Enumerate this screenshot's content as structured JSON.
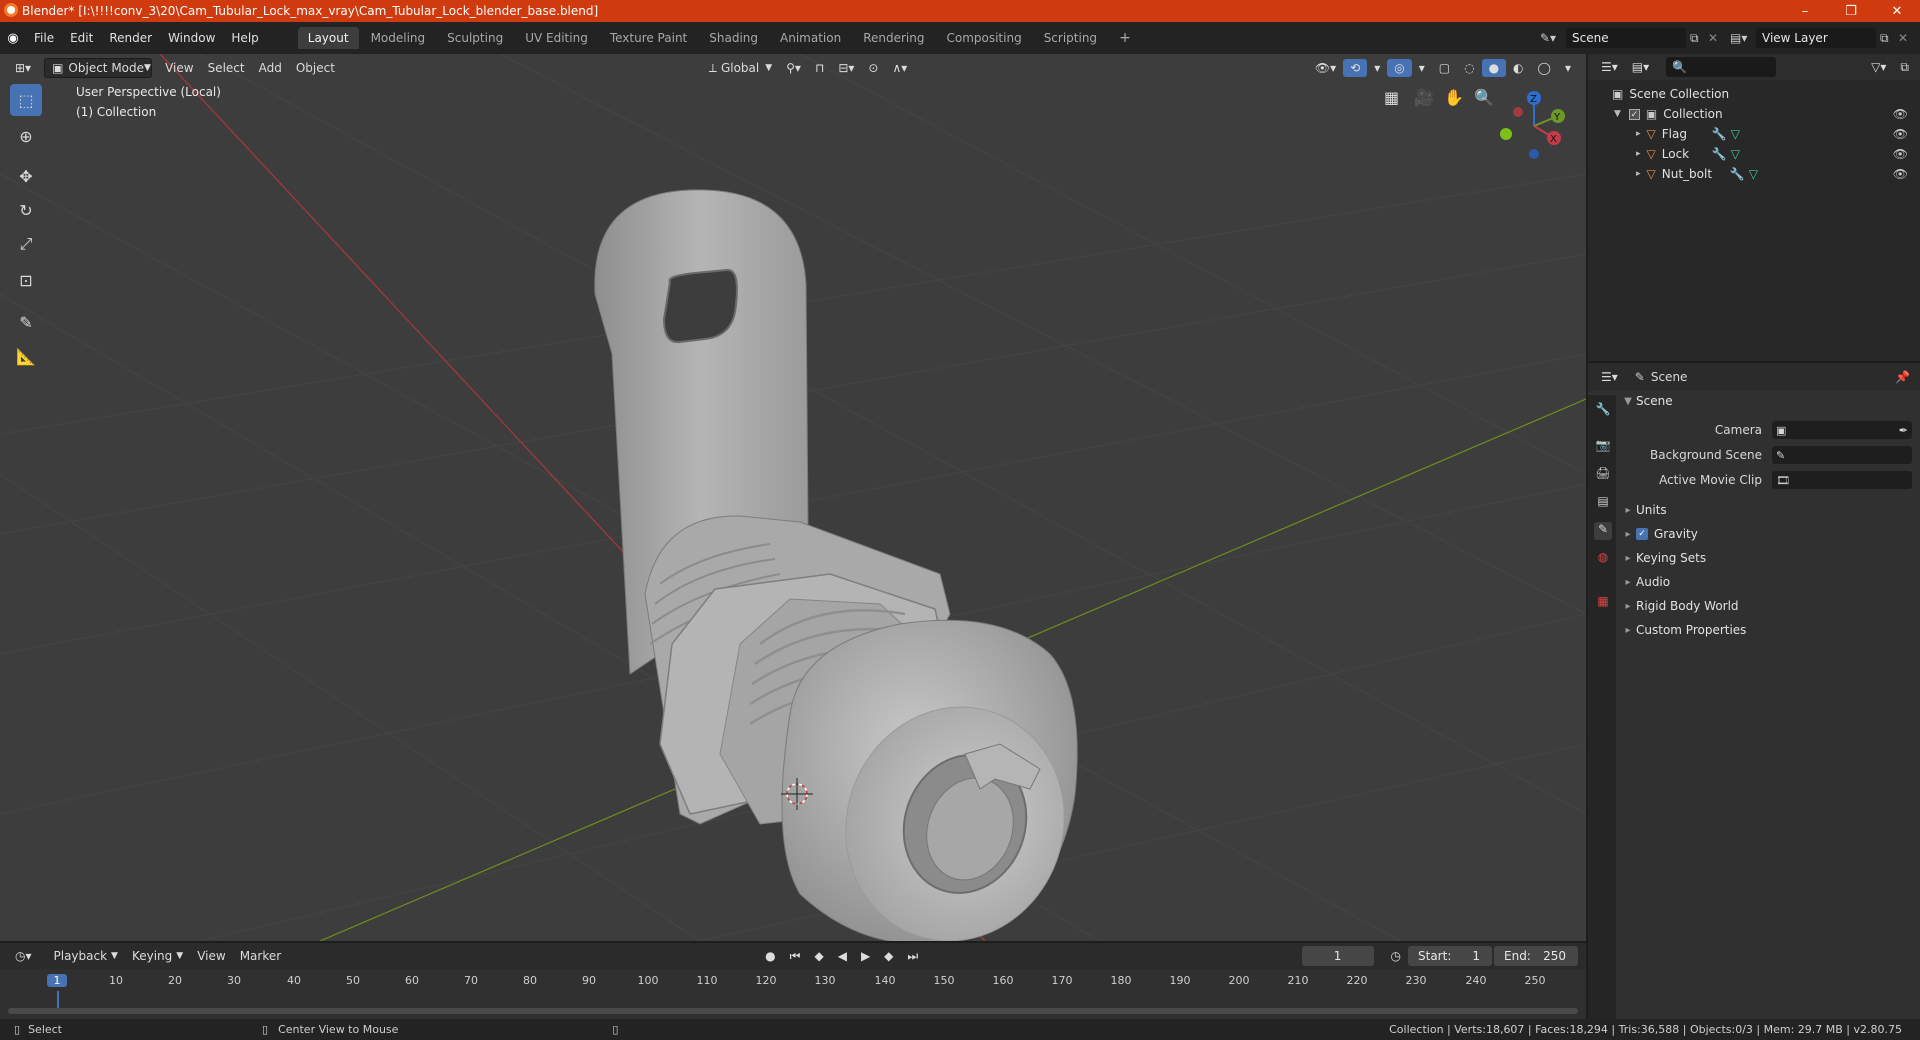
{
  "window": {
    "title": "Blender* [I:\\!!!!conv_3\\20\\Cam_Tubular_Lock_max_vray\\Cam_Tubular_Lock_blender_base.blend]",
    "minimize": "–",
    "maximize": "❐",
    "close": "✕"
  },
  "menubar": {
    "items": [
      "File",
      "Edit",
      "Render",
      "Window",
      "Help"
    ]
  },
  "workspaces": [
    "Layout",
    "Modeling",
    "Sculpting",
    "UV Editing",
    "Texture Paint",
    "Shading",
    "Animation",
    "Rendering",
    "Compositing",
    "Scripting"
  ],
  "active_workspace": "Layout",
  "scene_selector": {
    "value": "Scene"
  },
  "view_layer_selector": {
    "value": "View Layer"
  },
  "viewport": {
    "mode": "Object Mode",
    "menus": [
      "View",
      "Select",
      "Add",
      "Object"
    ],
    "transform_orientation": "Global",
    "overlay_text": {
      "line1": "User Perspective (Local)",
      "line2": "(1) Collection"
    },
    "gizmo": {
      "z": "Z",
      "y": "Y",
      "x": "X"
    }
  },
  "outliner": {
    "root": "Scene Collection",
    "collection": "Collection",
    "objects": [
      "Flag",
      "Lock",
      "Nut_bolt"
    ]
  },
  "properties": {
    "header": "Scene",
    "section": "Scene",
    "fields": [
      {
        "label": "Camera",
        "value": ""
      },
      {
        "label": "Background Scene",
        "value": ""
      },
      {
        "label": "Active Movie Clip",
        "value": ""
      }
    ],
    "panels": [
      "Units",
      "Gravity",
      "Keying Sets",
      "Audio",
      "Rigid Body World",
      "Custom Properties"
    ],
    "gravity_checked": true
  },
  "timeline": {
    "menus": [
      "Playback",
      "Keying",
      "View",
      "Marker"
    ],
    "current_frame": "1",
    "start_label": "Start:",
    "start": "1",
    "end_label": "End:",
    "end": "250",
    "ticks": [
      "1",
      "10",
      "20",
      "30",
      "40",
      "50",
      "60",
      "70",
      "80",
      "90",
      "100",
      "110",
      "120",
      "130",
      "140",
      "150",
      "160",
      "170",
      "180",
      "190",
      "200",
      "210",
      "220",
      "230",
      "240",
      "250"
    ]
  },
  "statusbar": {
    "left": "Select",
    "middle": "Center View to Mouse",
    "right": "Collection | Verts:18,607 | Faces:18,294 | Tris:36,588 | Objects:0/3 | Mem: 29.7 MB | v2.80.75"
  },
  "colors": {
    "accent": "#4772b3",
    "titlebar": "#d03a0f",
    "viewport_bg": "#3d3d3d",
    "axis_x": "#a8383c",
    "axis_y": "#6d8f1c"
  }
}
